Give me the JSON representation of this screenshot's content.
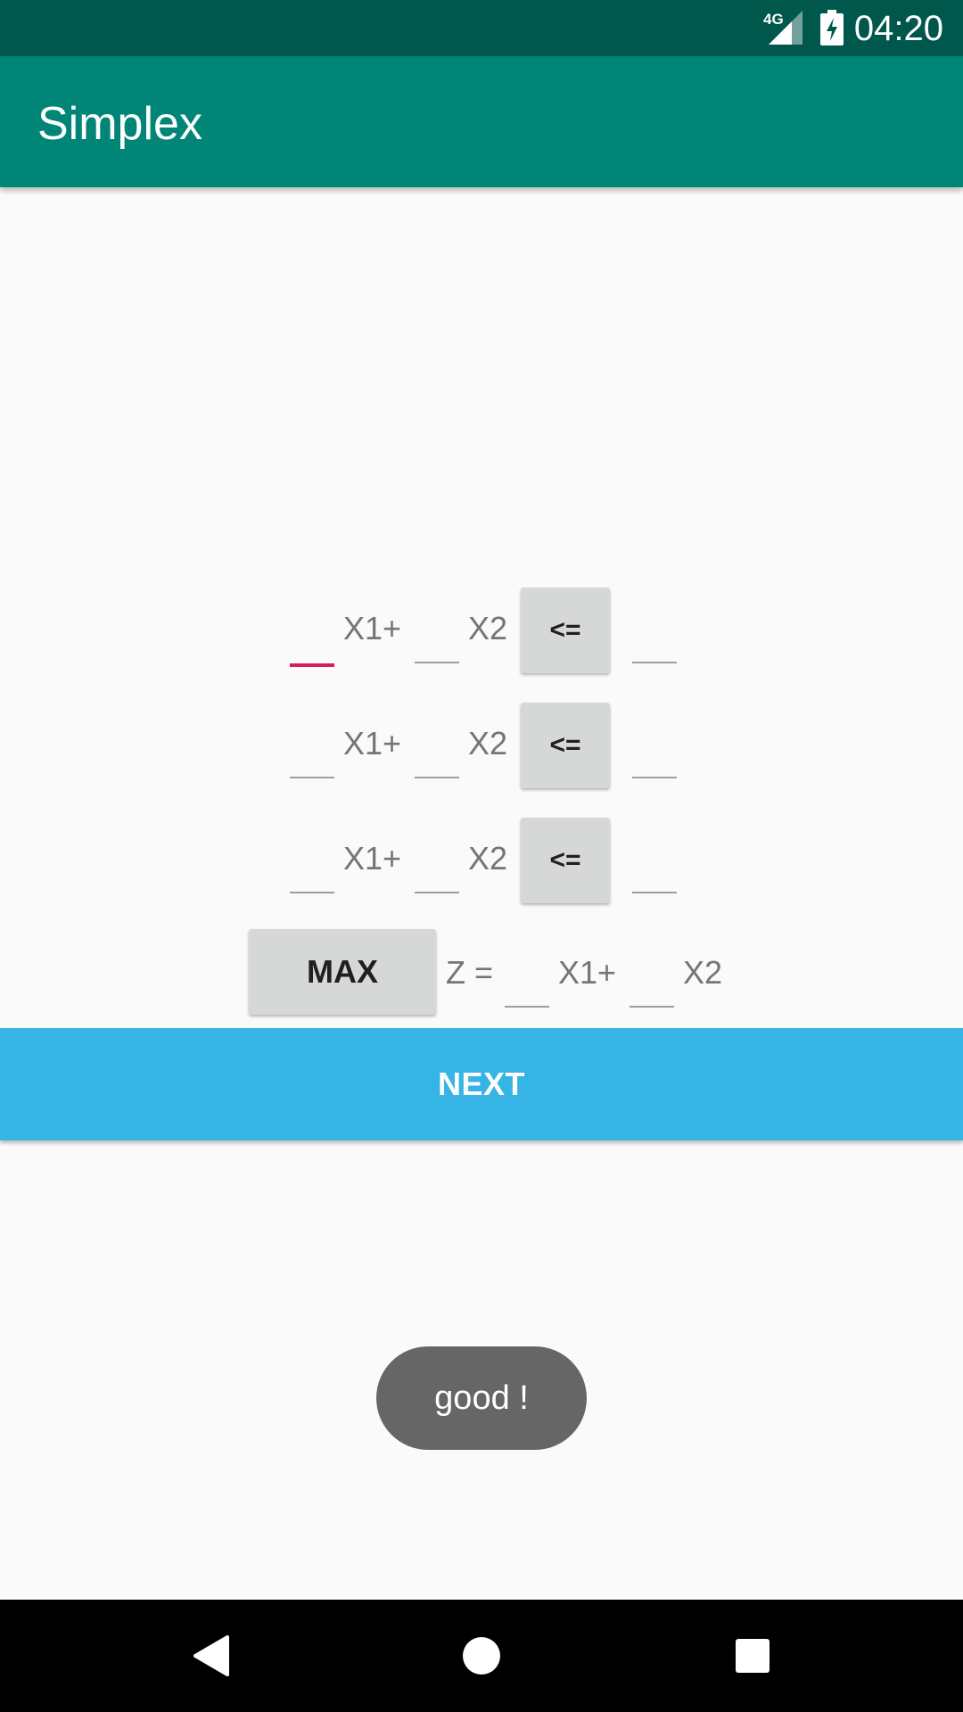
{
  "status_bar": {
    "time": "04:20",
    "network": "4G",
    "icons": [
      "signal-icon",
      "battery-charging-icon"
    ],
    "background": "#00574b"
  },
  "app_bar": {
    "title": "Simplex",
    "background": "#008577"
  },
  "constraints": [
    {
      "term1": "X1+",
      "term2": "X2",
      "operator": "<="
    },
    {
      "term1": "X1+",
      "term2": "X2",
      "operator": "<="
    },
    {
      "term1": "X1+",
      "term2": "X2",
      "operator": "<="
    }
  ],
  "objective": {
    "mode": "MAX",
    "z_label": "Z =",
    "term1": "X1+",
    "term2": "X2"
  },
  "next_button": {
    "label": "NEXT",
    "color": "#36b4e5"
  },
  "toast": {
    "message": "good !"
  },
  "nav_bar": {
    "icons": [
      "back-icon",
      "home-icon",
      "recents-icon"
    ]
  },
  "colors": {
    "accent": "#d81b60",
    "button_gray": "#d6d7d7"
  }
}
